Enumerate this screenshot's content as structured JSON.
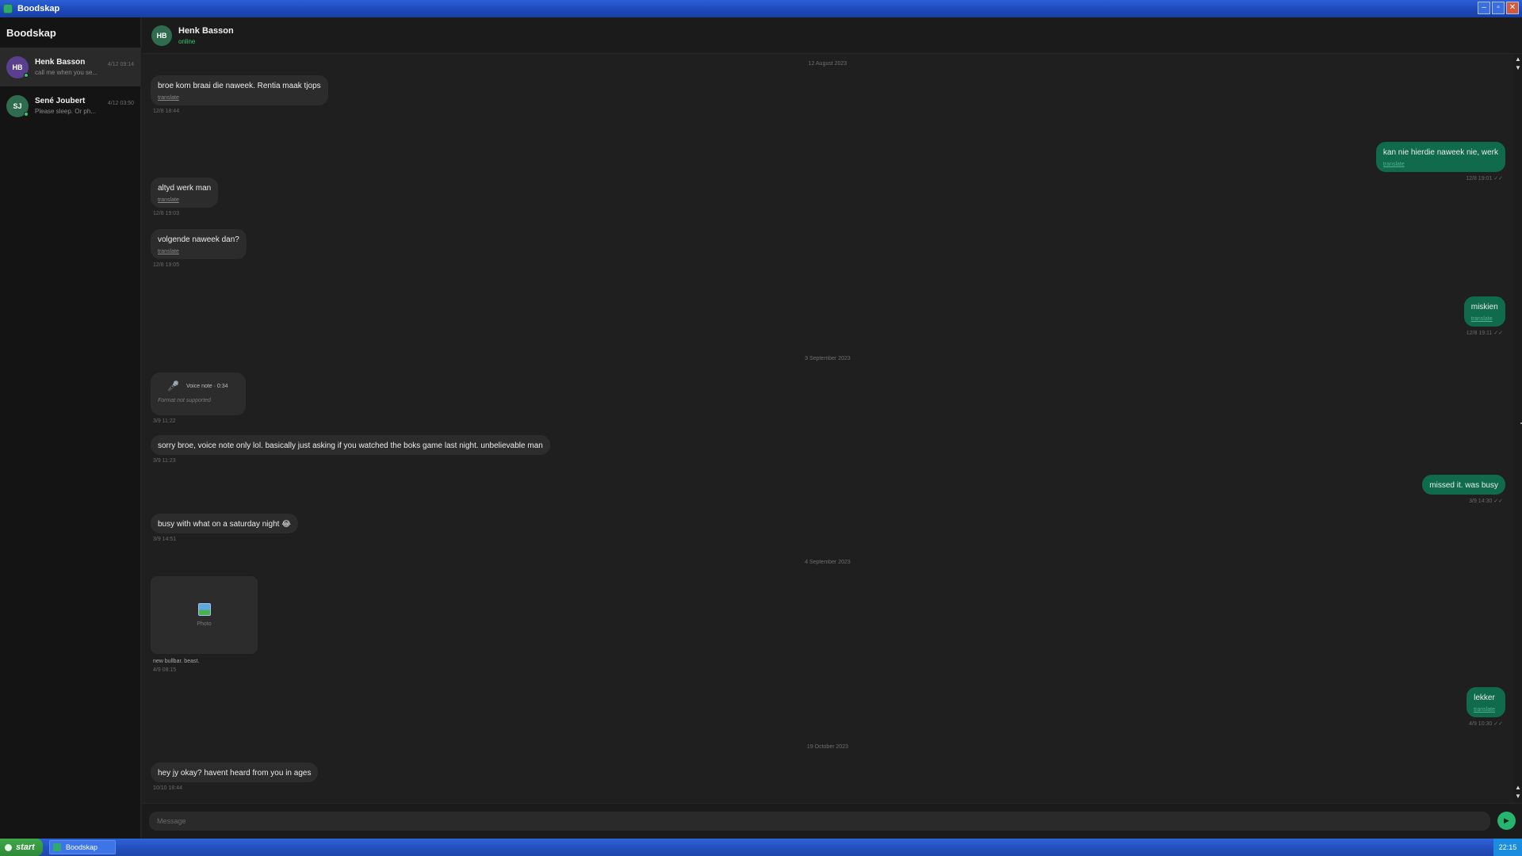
{
  "window": {
    "title": "Boodskap",
    "controls": {
      "minimize": "–",
      "maximize": "▫",
      "close": "✕"
    }
  },
  "sidebar": {
    "title": "Boodskap",
    "conversations": [
      {
        "initials": "HB",
        "name": "Henk Basson",
        "preview": "call me when you se...",
        "time": "4/12 09:14",
        "avatar_color": "#5b3f8f",
        "active": true
      },
      {
        "initials": "SJ",
        "name": "Sené Joubert",
        "preview": "Please sleep. Or ph...",
        "time": "4/12 03:50",
        "avatar_color": "#2e6b4f",
        "active": false
      }
    ]
  },
  "chat": {
    "header": {
      "initials": "HB",
      "name": "Henk Basson",
      "status": "online",
      "avatar_color": "#2e6b4f"
    },
    "separators": [
      "12 August 2023",
      "3 September 2023",
      "4 September 2023",
      "19 October 2023"
    ],
    "messages": [
      {
        "text": "broe kom braai die naweek. Rentia maak tjops",
        "translate": "translate",
        "meta": "12/8 18:44"
      },
      {
        "text": "kan nie hierdie naweek nie, werk",
        "translate": "translate",
        "meta": "12/8 19:01 ✓✓"
      },
      {
        "text": "altyd werk man",
        "translate": "translate",
        "meta": "12/8 19:03"
      },
      {
        "text": "volgende naweek dan?",
        "translate": "translate",
        "meta": "12/8 19:05"
      },
      {
        "text": "miskien",
        "translate": "translate",
        "meta": "12/8 19:11 ✓✓"
      },
      {
        "voice_label": "Voice note · 0:34",
        "voice_note": "Format not supported",
        "meta": "3/9 11:22"
      },
      {
        "text": "sorry broe, voice note only lol. basically just asking if you watched the boks game last night. unbelievable man",
        "meta": "3/9 11:23"
      },
      {
        "text": "missed it. was busy",
        "meta": "3/9 14:30 ✓✓"
      },
      {
        "text": "busy with what on a saturday night 😂",
        "meta": "3/9 14:51"
      },
      {
        "photo_label": "Photo",
        "caption": "new bullbar. beast.",
        "meta": "4/9 08:15"
      },
      {
        "text": "lekker",
        "translate": "translate",
        "meta": "4/9 10:30 ✓✓"
      },
      {
        "text": "hey jy okay? havent heard from you in ages",
        "meta": "10/10 18:44"
      }
    ]
  },
  "composer": {
    "placeholder": "Message",
    "send_icon": "send-icon"
  },
  "taskbar": {
    "start_label": "start",
    "task_label": "Boodskap",
    "clock": "22:15"
  },
  "colors": {
    "accent": "#26b56f",
    "outgoing_bubble": "#0f6b4c",
    "incoming_bubble": "#2c2c2c",
    "online": "#2ecc71"
  }
}
